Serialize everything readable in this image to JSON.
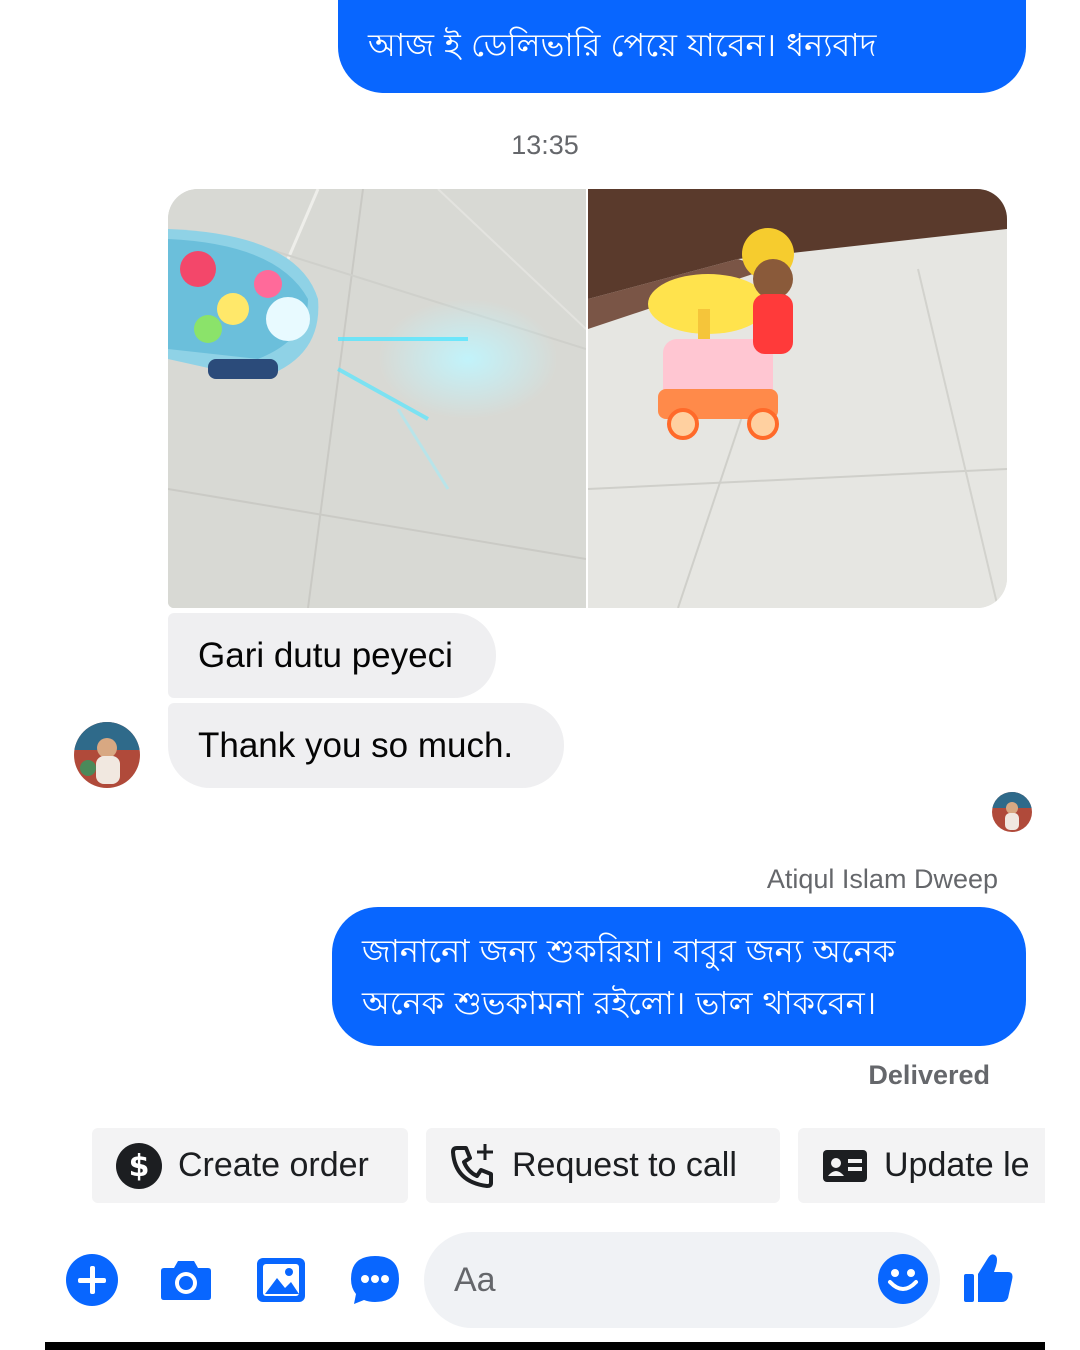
{
  "conversation": {
    "messages": {
      "top_outgoing": "আজ ই ডেলিভারি পেয়ে যাবেন। ধন্যবাদ",
      "timestamp": "13:35",
      "incoming_1": "Gari dutu peyeci",
      "incoming_2": "Thank you so much.",
      "reply_sender": "Atiqul Islam Dweep",
      "reply_line_1": "জানানো জন্য শুকরিয়া।  বাবুর জন্য অনেক",
      "reply_line_2": "অনেক শুভকামনা রইলো।  ভাল থাকবেন।",
      "status": "Delivered"
    }
  },
  "quick_replies": {
    "create_order": "Create order",
    "request_call": "Request to call",
    "update": "Update le"
  },
  "composer": {
    "placeholder": "Aa"
  },
  "colors": {
    "accent": "#0866ff",
    "incoming_bubble": "#efeff1",
    "secondary_text": "#65676b"
  }
}
